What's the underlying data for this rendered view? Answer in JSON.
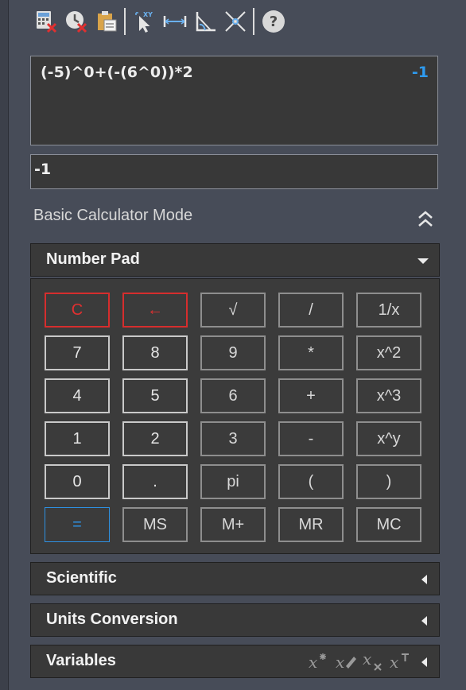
{
  "toolbar": {
    "icons": [
      "clear-calculator-icon",
      "clear-history-icon",
      "paste-icon",
      "pick-coordinate-icon",
      "measure-distance-icon",
      "measure-angle-icon",
      "intersection-icon",
      "help-icon"
    ]
  },
  "history": {
    "expression": "(-5)^0+(-(6^0))*2",
    "result": "-1"
  },
  "input": {
    "value": "-1"
  },
  "mode": {
    "label": "Basic Calculator Mode"
  },
  "panels": {
    "number_pad": "Number Pad",
    "scientific": "Scientific",
    "units_conversion": "Units Conversion",
    "variables": "Variables"
  },
  "keys": [
    [
      "C",
      "←",
      "√",
      "/",
      "1/x"
    ],
    [
      "7",
      "8",
      "9",
      "*",
      "x^2"
    ],
    [
      "4",
      "5",
      "6",
      "+",
      "x^3"
    ],
    [
      "1",
      "2",
      "3",
      "-",
      "x^y"
    ],
    [
      "0",
      ".",
      "pi",
      "(",
      ")"
    ],
    [
      "=",
      "MS",
      "M+",
      "MR",
      "MC"
    ]
  ],
  "colors": {
    "accent_blue": "#2e9bf0",
    "clear_red": "#d62d2d",
    "background": "#474c58",
    "panel": "#393939"
  }
}
